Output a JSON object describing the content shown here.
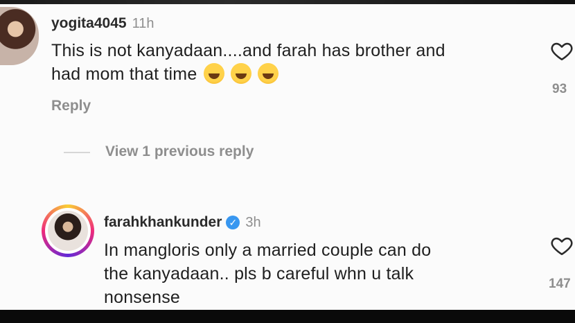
{
  "comments": [
    {
      "username": "yogita4045",
      "time": "11h",
      "text_line1": "This is not kanyadaan....and farah has brother and",
      "text_line2": "had mom that time",
      "emojis": [
        "😂",
        "😂",
        "😂"
      ],
      "likes": "93",
      "reply_label": "Reply"
    },
    {
      "username": "farahkhankunder",
      "verified": true,
      "time": "3h",
      "text_line1": "In mangloris only a married couple can do",
      "text_line2": "the kanyadaan.. pls b careful whn u talk",
      "text_line3": "nonsense",
      "likes": "147"
    }
  ],
  "view_replies_label": "View 1 previous reply",
  "icons": {
    "heart": "heart-outline-icon",
    "verified": "verified-badge-icon"
  },
  "colors": {
    "background": "#fbfbfb",
    "text": "#1f1f1f",
    "muted": "#8e8e8e",
    "verified": "#3897f0"
  }
}
